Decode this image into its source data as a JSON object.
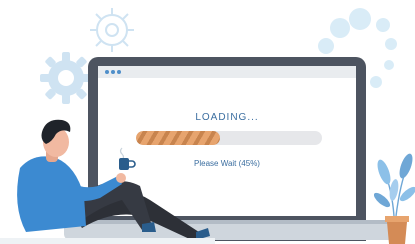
{
  "loading": {
    "title": "LOADING...",
    "status": "Please Wait (45%)",
    "progress": 0.45
  },
  "colors": {
    "accent": "#3b6ea0",
    "progress_fill": "#e7a46e",
    "progress_stripe": "#c8844e",
    "shirt": "#3c8ad1",
    "gear": "#cfe3f2",
    "bubble": "#d9ecf7"
  },
  "icons": [
    "gear-icon",
    "window-dots-icon",
    "coffee-cup-icon",
    "potted-plant-icon"
  ]
}
